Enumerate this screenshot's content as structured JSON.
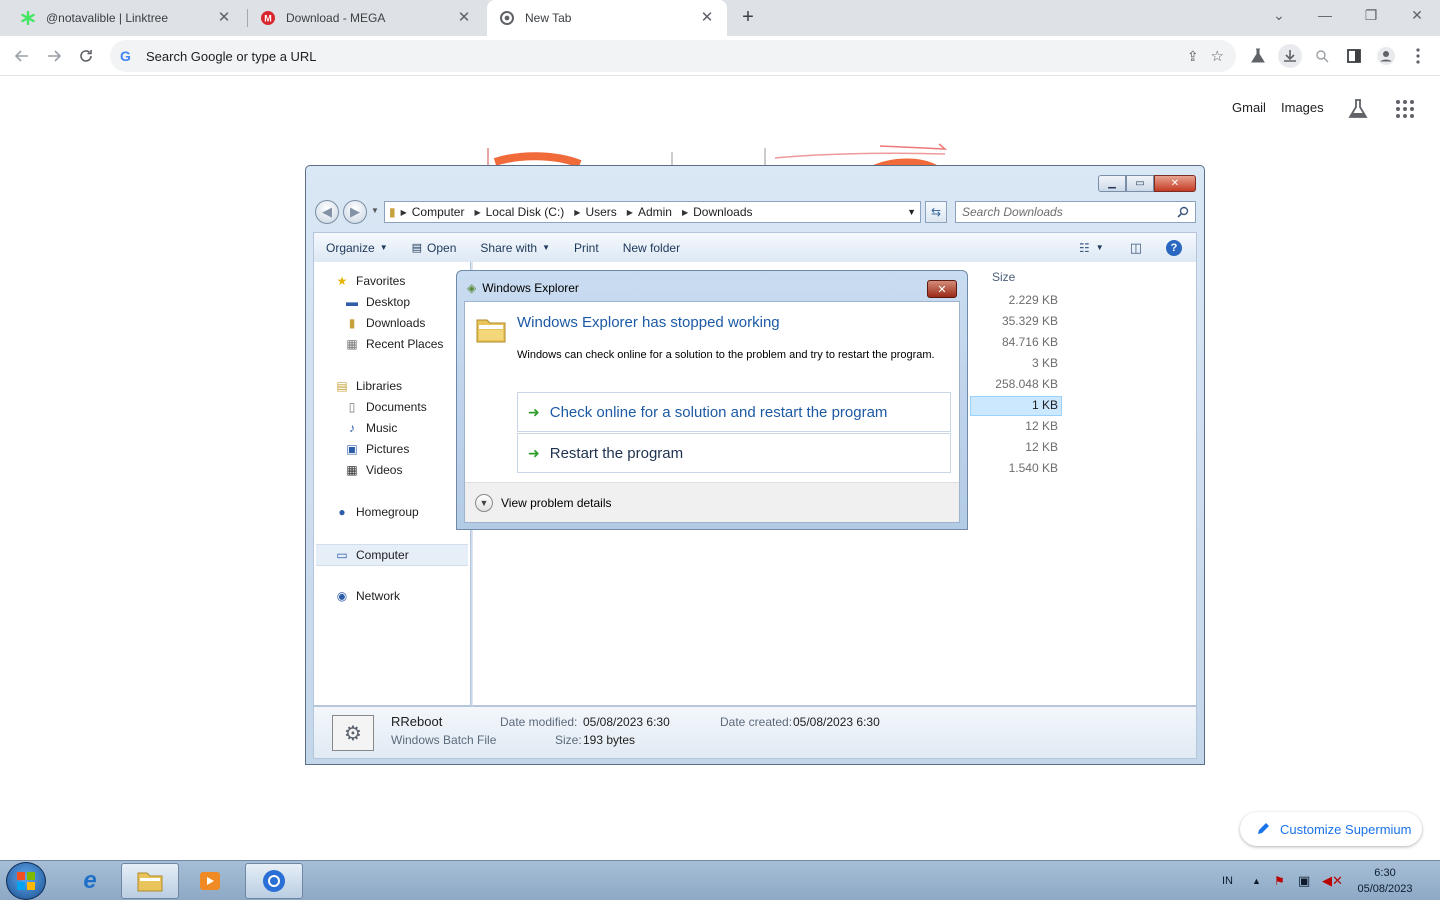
{
  "browser": {
    "tabs": [
      {
        "label": "@notavalible | Linktree",
        "icon": "linktree-icon"
      },
      {
        "label": "Download - MEGA",
        "icon": "mega-icon"
      },
      {
        "label": "New Tab",
        "icon": "chrome-icon"
      }
    ],
    "omnibox_placeholder": "Search Google or type a URL"
  },
  "ntp": {
    "gmail": "Gmail",
    "images": "Images",
    "customize": "Customize Supermium"
  },
  "explorer": {
    "breadcrumbs": [
      "Computer",
      "Local Disk (C:)",
      "Users",
      "Admin",
      "Downloads"
    ],
    "search_placeholder": "Search Downloads",
    "commands": {
      "organize": "Organize",
      "open": "Open",
      "share": "Share with",
      "print": "Print",
      "newfolder": "New folder"
    },
    "nav": {
      "favorites": "Favorites",
      "desktop": "Desktop",
      "downloads": "Downloads",
      "recent": "Recent Places",
      "libraries": "Libraries",
      "documents": "Documents",
      "music": "Music",
      "pictures": "Pictures",
      "videos": "Videos",
      "homegroup": "Homegroup",
      "computer": "Computer",
      "network": "Network"
    },
    "size_header": "Size",
    "sizes": [
      "2.229 KB",
      "35.329 KB",
      "84.716 KB",
      "3 KB",
      "258.048 KB",
      "1 KB",
      "12 KB",
      "12 KB",
      "1.540 KB"
    ],
    "details": {
      "name": "RReboot",
      "type": "Windows Batch File",
      "modified_label": "Date modified:",
      "modified": "05/08/2023 6:30",
      "size_label": "Size:",
      "size": "193 bytes",
      "created_label": "Date created:",
      "created": "05/08/2023 6:30"
    }
  },
  "dialog": {
    "title": "Windows Explorer",
    "heading": "Windows Explorer has stopped working",
    "text": "Windows can check online for a solution to the problem and try to restart the program.",
    "option1": "Check online for a solution and restart the program",
    "option2": "Restart the program",
    "details": "View problem details"
  },
  "taskbar": {
    "lang": "IN",
    "time": "6:30",
    "date": "05/08/2023"
  }
}
